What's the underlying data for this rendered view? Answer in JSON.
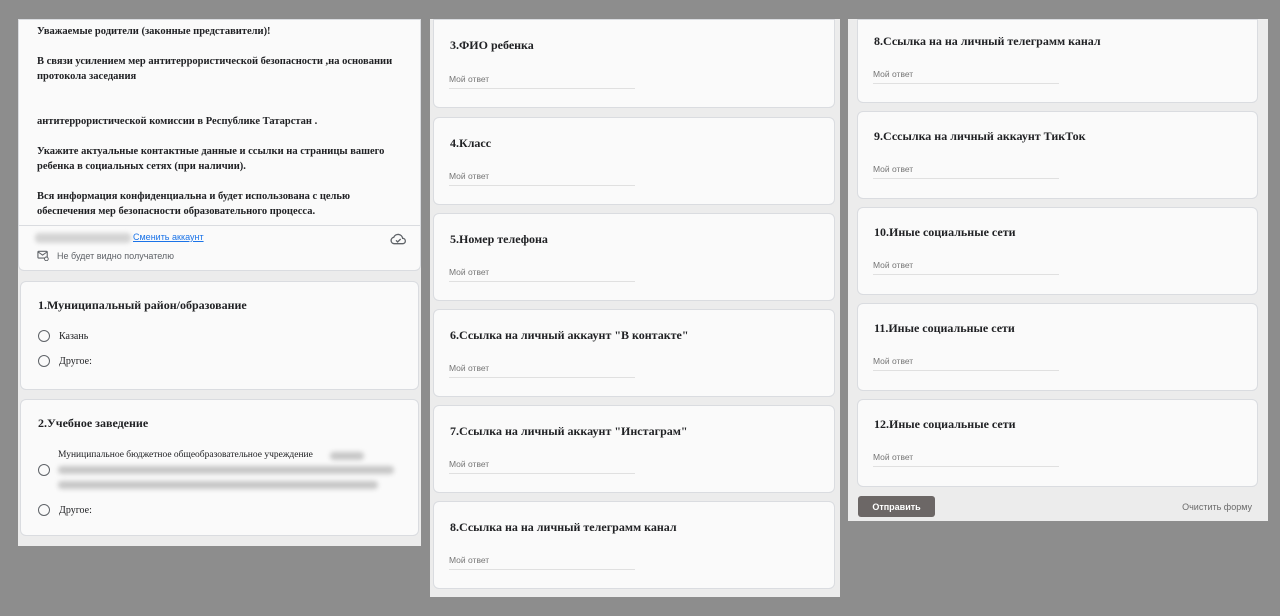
{
  "intro": {
    "paragraphs": [
      "Уважаемые родители (законные представители)!",
      "В связи усилением мер антитеррористической безопасности ,на основании протокола  заседания",
      " антитеррористической  комиссии    в Республике Татарстан .",
      "Укажите актуальные контактные данные и ссылки на страницы вашего ребенка в социальных сетях (при наличии).",
      "Вся информация конфиденциальна и будет использована с целью обеспечения мер безопасности образовательного процесса."
    ],
    "switch_account": "Сменить аккаунт",
    "not_visible_note": "Не будет видно получателю"
  },
  "q1": {
    "title": "1.Муниципальный район/образование",
    "options": [
      "Казань",
      "Другое:"
    ]
  },
  "q2": {
    "title": "2.Учебное заведение",
    "option1": "Муниципальное бюджетное общеобразовательное учреждение",
    "option2": "Другое:"
  },
  "answer_placeholder": "Мой ответ",
  "questions": {
    "q3": "3.ФИО ребенка",
    "q4": "4.Класс",
    "q5": "5.Номер телефона",
    "q6": "6.Ссылка на личный аккаунт \"В контакте\"",
    "q7": "7.Ссылка на личный аккаунт  \"Инстаграм\"",
    "q8": "8.Ссылка на на личный телеграмм канал",
    "q9": "9.Сссылка на личный аккаунт  ТикТок",
    "q10": "10.Иные социальные сети",
    "q11": "11.Иные социальные сети",
    "q12": "12.Иные социальные сети"
  },
  "footer": {
    "submit": "Отправить",
    "clear": "Очистить форму"
  }
}
